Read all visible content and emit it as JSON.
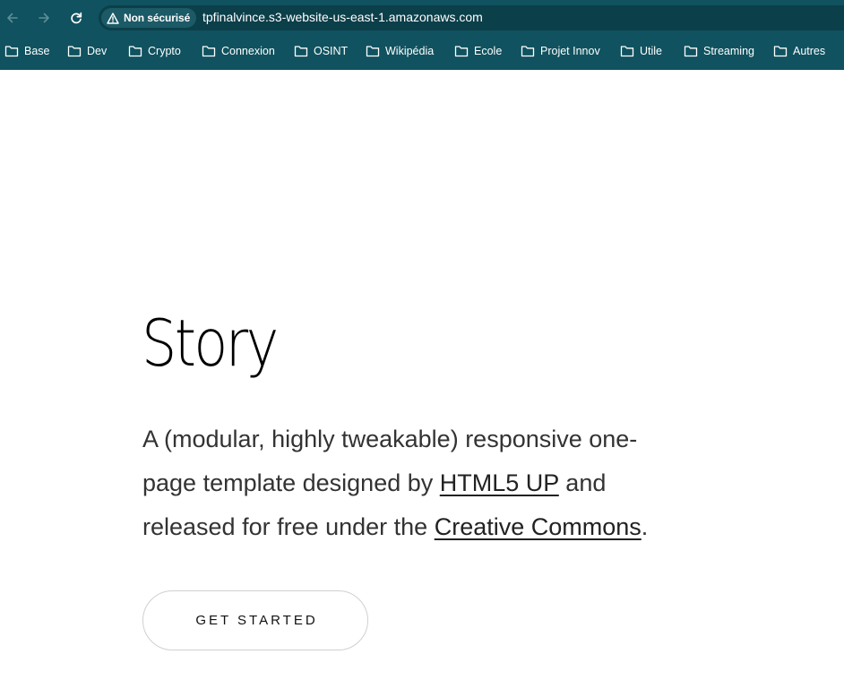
{
  "browser": {
    "security_label": "Non sécurisé",
    "url": "tpfinalvince.s3-website-us-east-1.amazonaws.com",
    "bookmarks": [
      {
        "label": "Base"
      },
      {
        "label": "Dev"
      },
      {
        "label": "Crypto"
      },
      {
        "label": "Connexion"
      },
      {
        "label": "OSINT"
      },
      {
        "label": "Wikipédia"
      },
      {
        "label": "Ecole"
      },
      {
        "label": "Projet Innov"
      },
      {
        "label": "Utile"
      },
      {
        "label": "Streaming"
      },
      {
        "label": "Autres"
      }
    ],
    "icons": {
      "back": "arrow-left-icon",
      "forward": "arrow-right-icon",
      "reload": "reload-icon",
      "security": "warning-triangle-icon",
      "bookmark": "folder-icon"
    },
    "colors": {
      "chrome_background": "#10525f",
      "omnibox_background": "#0b3f4a"
    }
  },
  "hero": {
    "title": "Story",
    "text_line1": "A (modular, highly tweakable) responsive one-",
    "text_line2_prefix": "page template designed by ",
    "link_html5up": "HTML5 UP",
    "text_line2_suffix": " and",
    "text_line3_prefix": "released for free under the ",
    "link_cc": "Creative Commons",
    "text_line3_suffix": ".",
    "cta_label": "Get Started"
  }
}
